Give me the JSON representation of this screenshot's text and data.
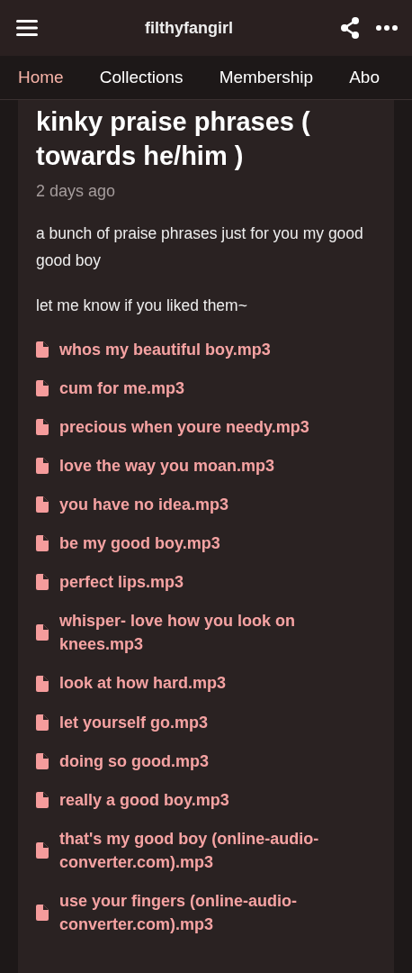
{
  "header": {
    "title": "filthyfangirl"
  },
  "tabs": [
    {
      "label": "Home",
      "selected": true
    },
    {
      "label": "Collections",
      "selected": false
    },
    {
      "label": "Membership",
      "selected": false
    },
    {
      "label": "Abo",
      "selected": false
    }
  ],
  "post": {
    "title": "kinky praise phrases ( towards he/him )",
    "date": "2 days ago",
    "paragraphs": [
      "a bunch of praise phrases just for you my good good boy",
      "let me know if you liked them~"
    ],
    "attachments": [
      "whos my beautiful boy.mp3",
      "cum for me.mp3",
      "precious when youre needy.mp3",
      "love the way you moan.mp3",
      "you have no idea.mp3",
      "be my good boy.mp3",
      "perfect lips.mp3",
      "whisper- love how you look on knees.mp3",
      "look at how hard.mp3",
      "let yourself go.mp3",
      "doing so good.mp3",
      "really a good boy.mp3",
      "that's my good boy (online-audio-converter.com).mp3",
      "use your fingers (online-audio-converter.com).mp3"
    ]
  }
}
